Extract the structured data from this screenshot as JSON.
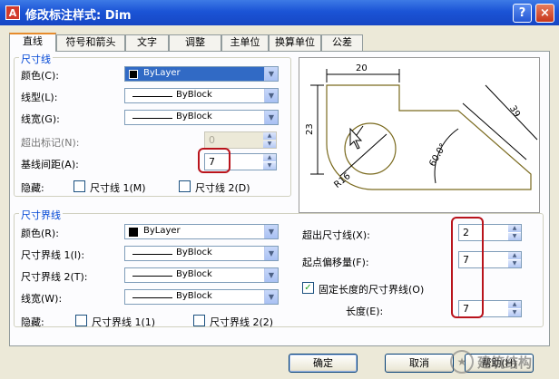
{
  "window": {
    "title": "修改标注样式: Dim",
    "help_label": "?",
    "close_label": "×"
  },
  "tabs": [
    "直线",
    "符号和箭头",
    "文字",
    "调整",
    "主单位",
    "换算单位",
    "公差"
  ],
  "dim_lines": {
    "legend": "尺寸线",
    "color_label": "颜色(C):",
    "color_value": "ByLayer",
    "linetype_label": "线型(L):",
    "linetype_value": "ByBlock",
    "lineweight_label": "线宽(G):",
    "lineweight_value": "ByBlock",
    "extend_label": "超出标记(N):",
    "extend_value": "0",
    "baseline_label": "基线间距(A):",
    "baseline_value": "7",
    "suppress_label": "隐藏:",
    "suppress1_label": "尺寸线 1(M)",
    "suppress2_label": "尺寸线 2(D)"
  },
  "ext_lines": {
    "legend": "尺寸界线",
    "color_label": "颜色(R):",
    "color_value": "ByLayer",
    "linetype1_label": "尺寸界线 1(I):",
    "linetype1_value": "ByBlock",
    "linetype2_label": "尺寸界线 2(T):",
    "linetype2_value": "ByBlock",
    "lineweight_label": "线宽(W):",
    "lineweight_value": "ByBlock",
    "suppress_label": "隐藏:",
    "suppress1_label": "尺寸界线 1(1)",
    "suppress2_label": "尺寸界线 2(2)",
    "extend_label": "超出尺寸线(X):",
    "extend_value": "2",
    "offset_label": "起点偏移量(F):",
    "offset_value": "7",
    "fixed_label": "固定长度的尺寸界线(O)",
    "fixed_checked": "✓",
    "length_label": "长度(E):",
    "length_value": "7"
  },
  "preview": {
    "dim_top": "20",
    "dim_left": "23",
    "dim_right": "39",
    "dim_angle": "60.0°",
    "dim_radius": "R16"
  },
  "buttons": {
    "ok": "确定",
    "cancel": "取消",
    "help": "帮助(H)"
  },
  "watermark": {
    "icon": "★",
    "text": "建筑结构"
  },
  "colors": {
    "accent": "#0046d5",
    "titlebar": "#1b54d6",
    "highlight": "#b9141c",
    "drawing": "#7a6a1e"
  }
}
